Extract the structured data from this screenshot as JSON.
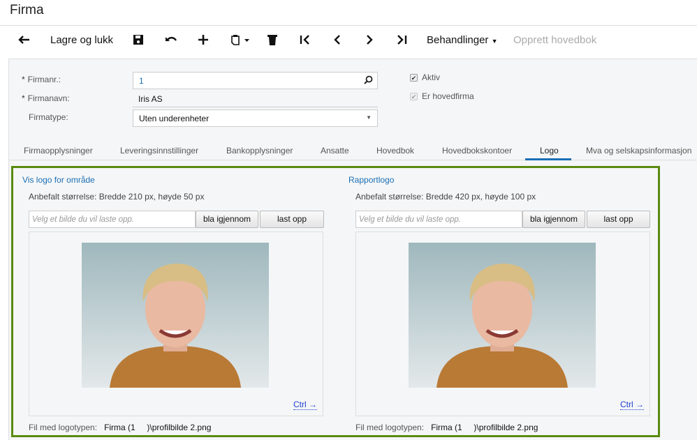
{
  "title": "Firma",
  "toolbar": {
    "save_close": "Lagre og lukk",
    "actions": "Behandlinger",
    "create_ledger": "Opprett hovedbok"
  },
  "form": {
    "firmanr_label": "Firmanr.:",
    "firmanr_value": "1",
    "firmanavn_label": "Firmanavn:",
    "firmanavn_value": "Iris AS",
    "firmatype_label": "Firmatype:",
    "firmatype_value": "Uten underenheter",
    "aktiv_label": "Aktiv",
    "hovedfirma_label": "Er hovedfirma",
    "required_mark": "*"
  },
  "tabs": [
    "Firmaopplysninger",
    "Leveringsinnstillinger",
    "Bankopplysninger",
    "Ansatte",
    "Hovedbok",
    "Hovedbokskontoer",
    "Logo",
    "Mva og selskapsinformasjon"
  ],
  "active_tab": "Logo",
  "logo": {
    "left": {
      "title": "Vis logo for område",
      "hint": "Anbefalt størrelse: Bredde 210 px, høyde 50 px",
      "placeholder": "Velg et bilde du vil laste opp.",
      "browse": "bla igjennom",
      "upload": "last opp",
      "ctrl": "Ctrl →",
      "file_label": "Fil med logotypen:",
      "file_value": "Firma (1     )\\profilbilde 2.png"
    },
    "right": {
      "title": "Rapportlogo",
      "hint": "Anbefalt størrelse: Bredde 420 px, høyde 100 px",
      "placeholder": "Velg et bilde du vil laste opp.",
      "browse": "bla igjennom",
      "upload": "last opp",
      "ctrl": "Ctrl →",
      "file_label": "Fil med logotypen:",
      "file_value": "Firma (1     )\\profilbilde 2.png"
    }
  },
  "colors": {
    "accent": "#1a6fb5",
    "highlight": "#5a8a12"
  }
}
